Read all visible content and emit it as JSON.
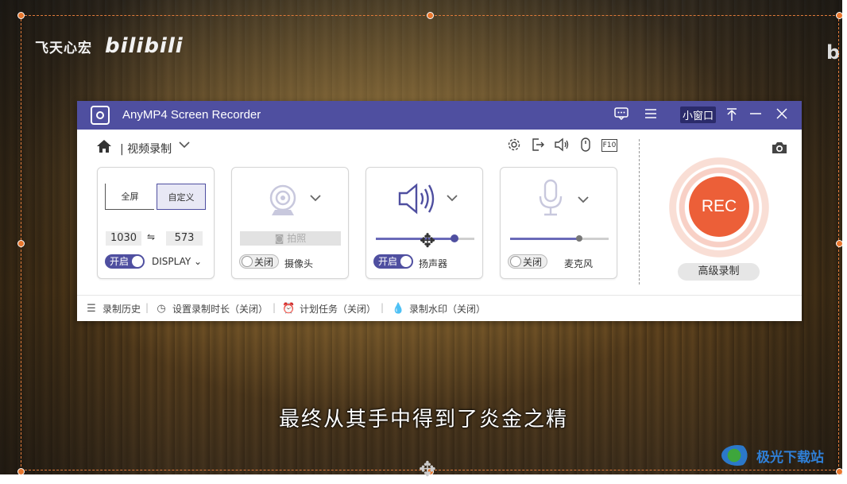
{
  "background": {
    "channel_name": "飞天心宏",
    "brand": "bilibili",
    "subtitle": "最终从其手中得到了炎金之精",
    "site_watermark": "极光下载站"
  },
  "window": {
    "title": "AnyMP4 Screen Recorder",
    "mini_window_label": "小窗口",
    "icons": [
      "feedback-icon",
      "menu-icon",
      "pin-icon",
      "minimize-icon",
      "close-icon"
    ]
  },
  "mode": {
    "label": "视频录制"
  },
  "tools": [
    "settings-icon",
    "export-icon",
    "speaker-icon",
    "mouse-icon",
    "f10-key-icon"
  ],
  "f10_label": "F10",
  "display_card": {
    "fullscreen_label": "全屏",
    "custom_label": "自定义",
    "width": "1030",
    "height": "573",
    "toggle_label": "开启",
    "display_label": "DISPLAY"
  },
  "webcam_card": {
    "snapshot_label": "拍照",
    "toggle_label": "关闭",
    "label": "摄像头"
  },
  "speaker_card": {
    "toggle_label": "开启",
    "label": "扬声器",
    "volume": 0.8
  },
  "mic_card": {
    "toggle_label": "关闭",
    "label": "麦克风",
    "volume": 0.7
  },
  "rec_button": "REC",
  "advanced_button": "高级录制",
  "bottom_bar": {
    "history": "录制历史",
    "duration": "设置录制时长（关闭）",
    "schedule": "计划任务（关闭）",
    "watermark": "录制水印（关闭）"
  },
  "colors": {
    "titlebar": "#4f4fa0",
    "rec": "#ec5f38",
    "capture_border": "#e07a3a"
  }
}
